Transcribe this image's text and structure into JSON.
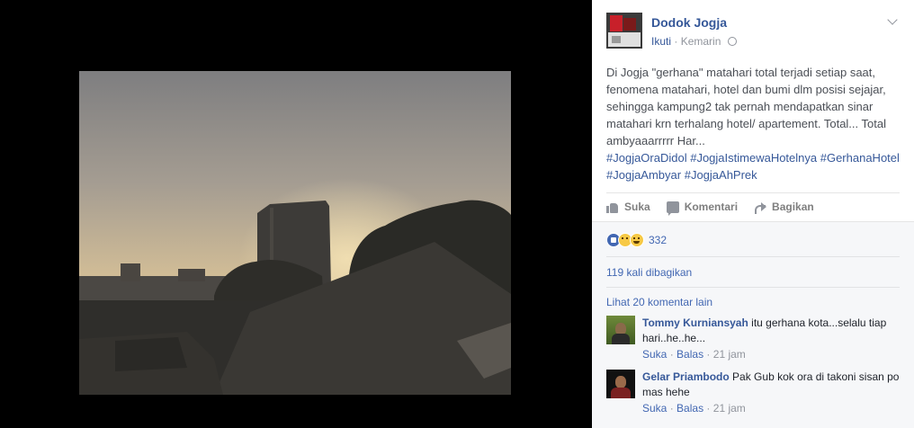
{
  "post": {
    "page_name": "Dodok Jogja",
    "follow_label": "Ikuti",
    "separator": "·",
    "time": "Kemarin",
    "body": "Di Jogja \"gerhana\" matahari total terjadi setiap saat, fenomena matahari, hotel dan bumi dlm posisi sejajar, sehingga kampung2 tak pernah mendapatkan sinar matahari krn terhalang hotel/ apartement. Total... Total ambyaaarrrrr Har...",
    "hashtags": "#JogjaOraDidol #JogjaIstimewaHotelnya #GerhanaHotel #JogjaAmbyar #JogjaAhPrek"
  },
  "actions": {
    "like": "Suka",
    "comment": "Komentari",
    "share": "Bagikan"
  },
  "reactions": {
    "icons": [
      "like-icon",
      "sad-icon",
      "haha-icon"
    ],
    "count": "332"
  },
  "shares": "119 kali dibagikan",
  "more_comments": "Lihat 20 komentar lain",
  "comments": [
    {
      "name": "Tommy Kurniansyah",
      "text": "itu gerhana kota...selalu tiap hari..he..he...",
      "like": "Suka",
      "reply": "Balas",
      "time": "21 jam"
    },
    {
      "name": "Gelar Priambodo",
      "text": "Pak Gub kok ora di takoni sisan po mas hehe",
      "like": "Suka",
      "reply": "Balas",
      "time": "21 jam"
    }
  ],
  "colors": {
    "link": "#365899",
    "accent": "#4267b2",
    "muted": "#90949c",
    "sky": "#c9b89a"
  }
}
